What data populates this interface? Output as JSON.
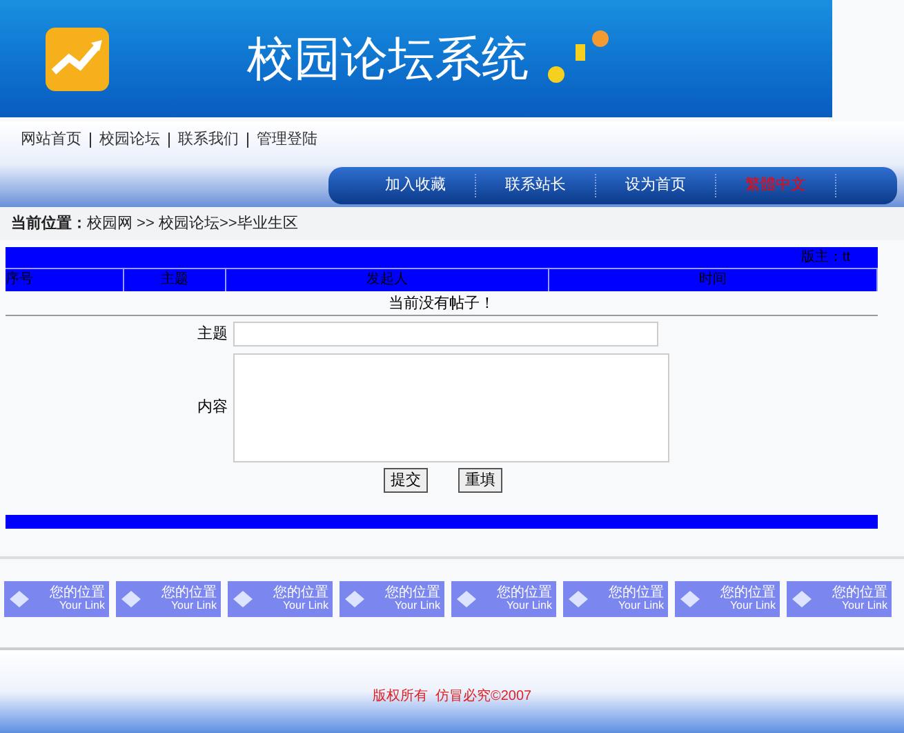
{
  "banner": {
    "title": "校园论坛系统"
  },
  "nav": {
    "links": [
      "网站首页",
      "校园论坛",
      "联系我们",
      "管理登陆"
    ]
  },
  "tabs": [
    {
      "label": "加入收藏",
      "color": "#ffffff"
    },
    {
      "label": "联系站长",
      "color": "#ffffff"
    },
    {
      "label": "设为首页",
      "color": "#ffffff"
    },
    {
      "label": "繁體中文",
      "color": "#ff0000"
    }
  ],
  "breadcrumb": {
    "label": "当前位置：",
    "path": "校园网 >> 校园论坛>>毕业生区"
  },
  "table": {
    "moderator": "版主：tt",
    "columns": [
      "序号",
      "主题",
      "发起人",
      "时间"
    ],
    "empty_message": "当前没有帖子！"
  },
  "form": {
    "subject_label": "主题",
    "content_label": "内容",
    "buttons": [
      "提交",
      "重填"
    ]
  },
  "links": [
    {
      "title": "您的位置",
      "subtitle": "Your Link"
    },
    {
      "title": "您的位置",
      "subtitle": "Your Link"
    },
    {
      "title": "您的位置",
      "subtitle": "Your Link"
    },
    {
      "title": "您的位置",
      "subtitle": "Your Link"
    },
    {
      "title": "您的位置",
      "subtitle": "Your Link"
    },
    {
      "title": "您的位置",
      "subtitle": "Your Link"
    },
    {
      "title": "您的位置",
      "subtitle": "Your Link"
    },
    {
      "title": "您的位置",
      "subtitle": "Your Link"
    }
  ],
  "footer": {
    "copyright": "版权所有  仿冒必究©2007"
  }
}
